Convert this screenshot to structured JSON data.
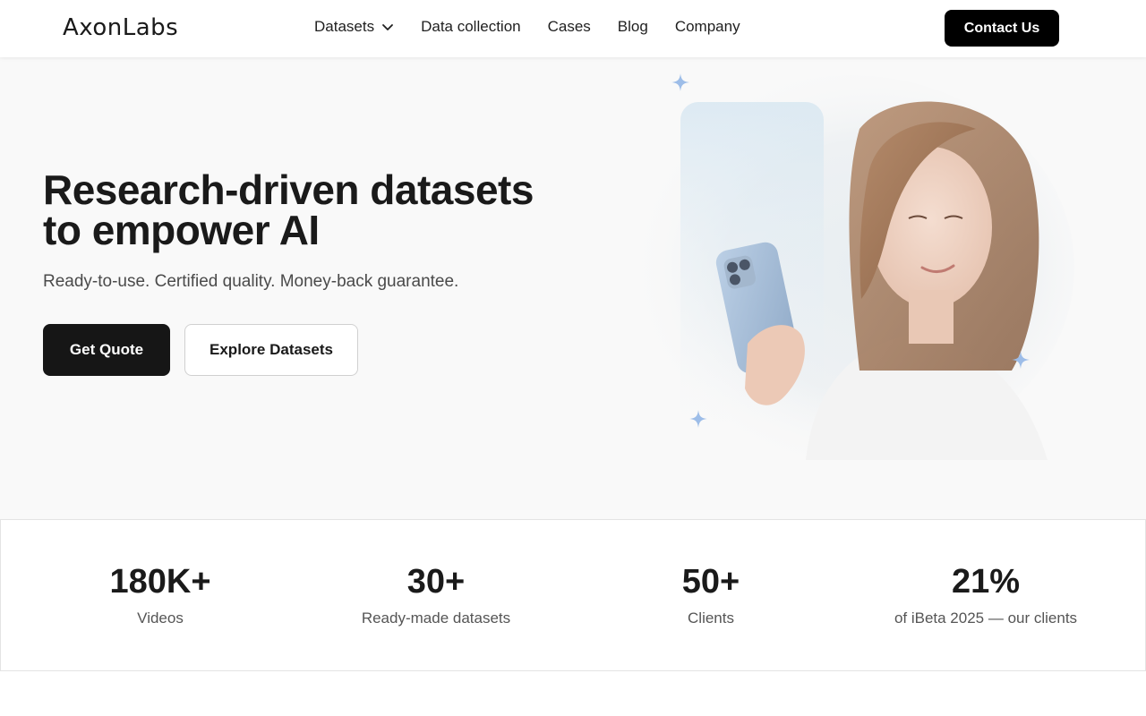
{
  "header": {
    "logo": "AxonLabs",
    "nav": [
      {
        "label": "Datasets",
        "has_dropdown": true
      },
      {
        "label": "Data collection"
      },
      {
        "label": "Cases"
      },
      {
        "label": "Blog"
      },
      {
        "label": "Company"
      }
    ],
    "contact_label": "Contact Us"
  },
  "hero": {
    "title_line1": "Research-driven datasets",
    "title_line2": "to empower AI",
    "subtitle": "Ready-to-use. Certified quality. Money-back guarantee.",
    "primary_button": "Get Quote",
    "secondary_button": "Explore Datasets",
    "image_icon": "woman-with-phone-illustration",
    "sparkle_color": "#9dbde8"
  },
  "stats": [
    {
      "value": "180K+",
      "label": "Videos"
    },
    {
      "value": "30+",
      "label": "Ready-made datasets"
    },
    {
      "value": "50+",
      "label": "Clients"
    },
    {
      "value": "21%",
      "label": "of iBeta 2025 — our clients"
    }
  ],
  "colors": {
    "brand_black": "#000000",
    "hero_bg": "#f9f9f9",
    "accent_blue": "#9dbde8"
  }
}
